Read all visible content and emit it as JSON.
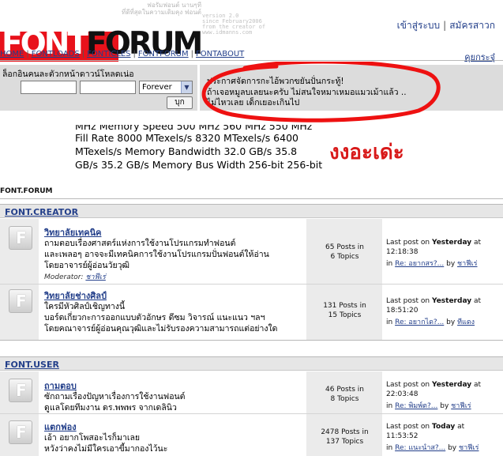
{
  "header": {
    "logo_part1": "FONT",
    "logo_part2": "FORUM",
    "slogan_lines": [
      "ฟอรัมฟอนต์ นานๆที",
      "ที่ดีที่สุดในความเดิมคุง ฟอนต์"
    ],
    "version_lines": [
      "version 2.0",
      "since February2006",
      "from the creator of",
      "www.idmanns.com"
    ],
    "login_link": "เข้าสู่ระบบ",
    "register_link": "สมัครสาวก"
  },
  "nav": {
    "items": [
      "HOME",
      "FONTLOADS",
      "FONTICLES",
      "FONTFORUM",
      "FONTABOUT"
    ],
    "right_link": "คุยกระจุ๋"
  },
  "login": {
    "title": "ล็อกอินคนละตัวกหน้าดาวน์โหลดเน่อ",
    "username_value": "",
    "password_value": "",
    "duration": "Forever",
    "submit": "บุก"
  },
  "announcement": {
    "line1": "ประกาศจัดการกะไอ้พวกขยันปั่นกระทู้!",
    "line2": "ถ้าเจอหมูลบเลยนะครับ ไม่สนใจหมาเหมอแมวเม้าแล้ว ..",
    "line3": "ไม่ไหวเลย เด็กเยอะเกินไป"
  },
  "spec": {
    "line1": "MHz   Memory Speed  500 MHz  560 MHz  550 MHz",
    "line2": "Fill Rate  8000 MTexels/s  8320 MTexels/s  6400",
    "line3": "MTexels/s   Memory Bandwidth  32.0 GB/s  35.8",
    "line4": "GB/s  35.2 GB/s   Memory Bus Width 256-bit 256-bit",
    "stamp": "งงอะเด่ะ"
  },
  "forum": {
    "label": "FONT.FORUM",
    "categories": [
      {
        "title": "FONT.CREATOR",
        "forums": [
          {
            "title": "วิทยาลัยเทคนิค",
            "desc1": "ถามตอบเรื่องศาสตร์แห่งการใช้งานโปรแกรมทำฟอนต์",
            "desc2": "และเพลอๆ อาจจะมีเทคนิคการใช้งานโปรแกรมปั่นฟอนต์ให้อ่าน",
            "desc3": "โดยอาจารย์ผู้อ่อนวัยวุฒิ",
            "moderator_label": "Moderator:",
            "moderator": "ชาฟีเร่",
            "posts": "65 Posts in",
            "topics": "6 Topics",
            "last_label": "Last post on",
            "last_day": "Yesterday",
            "last_at": "at",
            "last_time": "12:18:38",
            "last_in": "in",
            "last_re": "Re: อยากสร?...",
            "last_by": "by",
            "last_user": "ชาฟีเร่"
          },
          {
            "title": "วิทยาลัยช่างศิลป์",
            "desc1": "ใครมีหัวศิลป์เชิญทางนี้",
            "desc2": "บอร์ดเกี่ยวกะการออกแบบตัวอักษร ดีซม วิจารณ์ แนะแนว ฯลฯ",
            "desc3": "โดยคณาจารย์ผู้อ่อนคุณวุฒิและไม่รับรองความสามารถแต่อย่างใด",
            "posts": "131 Posts in",
            "topics": "15 Topics",
            "last_label": "Last post on",
            "last_day": "Yesterday",
            "last_at": "at",
            "last_time": "18:51:20",
            "last_in": "in",
            "last_re": "Re: อยากได?...",
            "last_by": "by",
            "last_user": "ทีแดง"
          }
        ]
      },
      {
        "title": "FONT.USER",
        "forums": [
          {
            "title": "ถามตอบ",
            "desc1": "ซักถามเรื่องปัญหาเรื่องการใช้งานฟอนต์",
            "desc2": "ดูแลโดยทีมงาน ดร.พพพร จากเดลินิว",
            "posts": "46 Posts in",
            "topics": "8 Topics",
            "last_label": "Last post on",
            "last_day": "Yesterday",
            "last_at": "at",
            "last_time": "22:03:48",
            "last_in": "in",
            "last_re": "Re: พิมพ์ต?...",
            "last_by": "by",
            "last_user": "ชาฟีเร่"
          },
          {
            "title": "แตกฟอง",
            "desc1": "เอ้า อยากโพสอะไรก็มาเลย",
            "desc2": "หวังว่าคงไม่มีใครเอาขี้มากองไว้นะ",
            "posts": "2478 Posts in",
            "topics": "137 Topics",
            "last_label": "Last post on",
            "last_day": "Today",
            "last_at": "at",
            "last_time": "11:53:52",
            "last_in": "in",
            "last_re": "Re: แนะนำส?...",
            "last_by": "by",
            "last_user": "ชาฟีเร่"
          }
        ]
      }
    ]
  },
  "colors": {
    "brand_red": "#e8121b",
    "link_blue": "#233f8a",
    "panel_gray": "#dcdcdc",
    "annotation_red": "#ee1111"
  }
}
